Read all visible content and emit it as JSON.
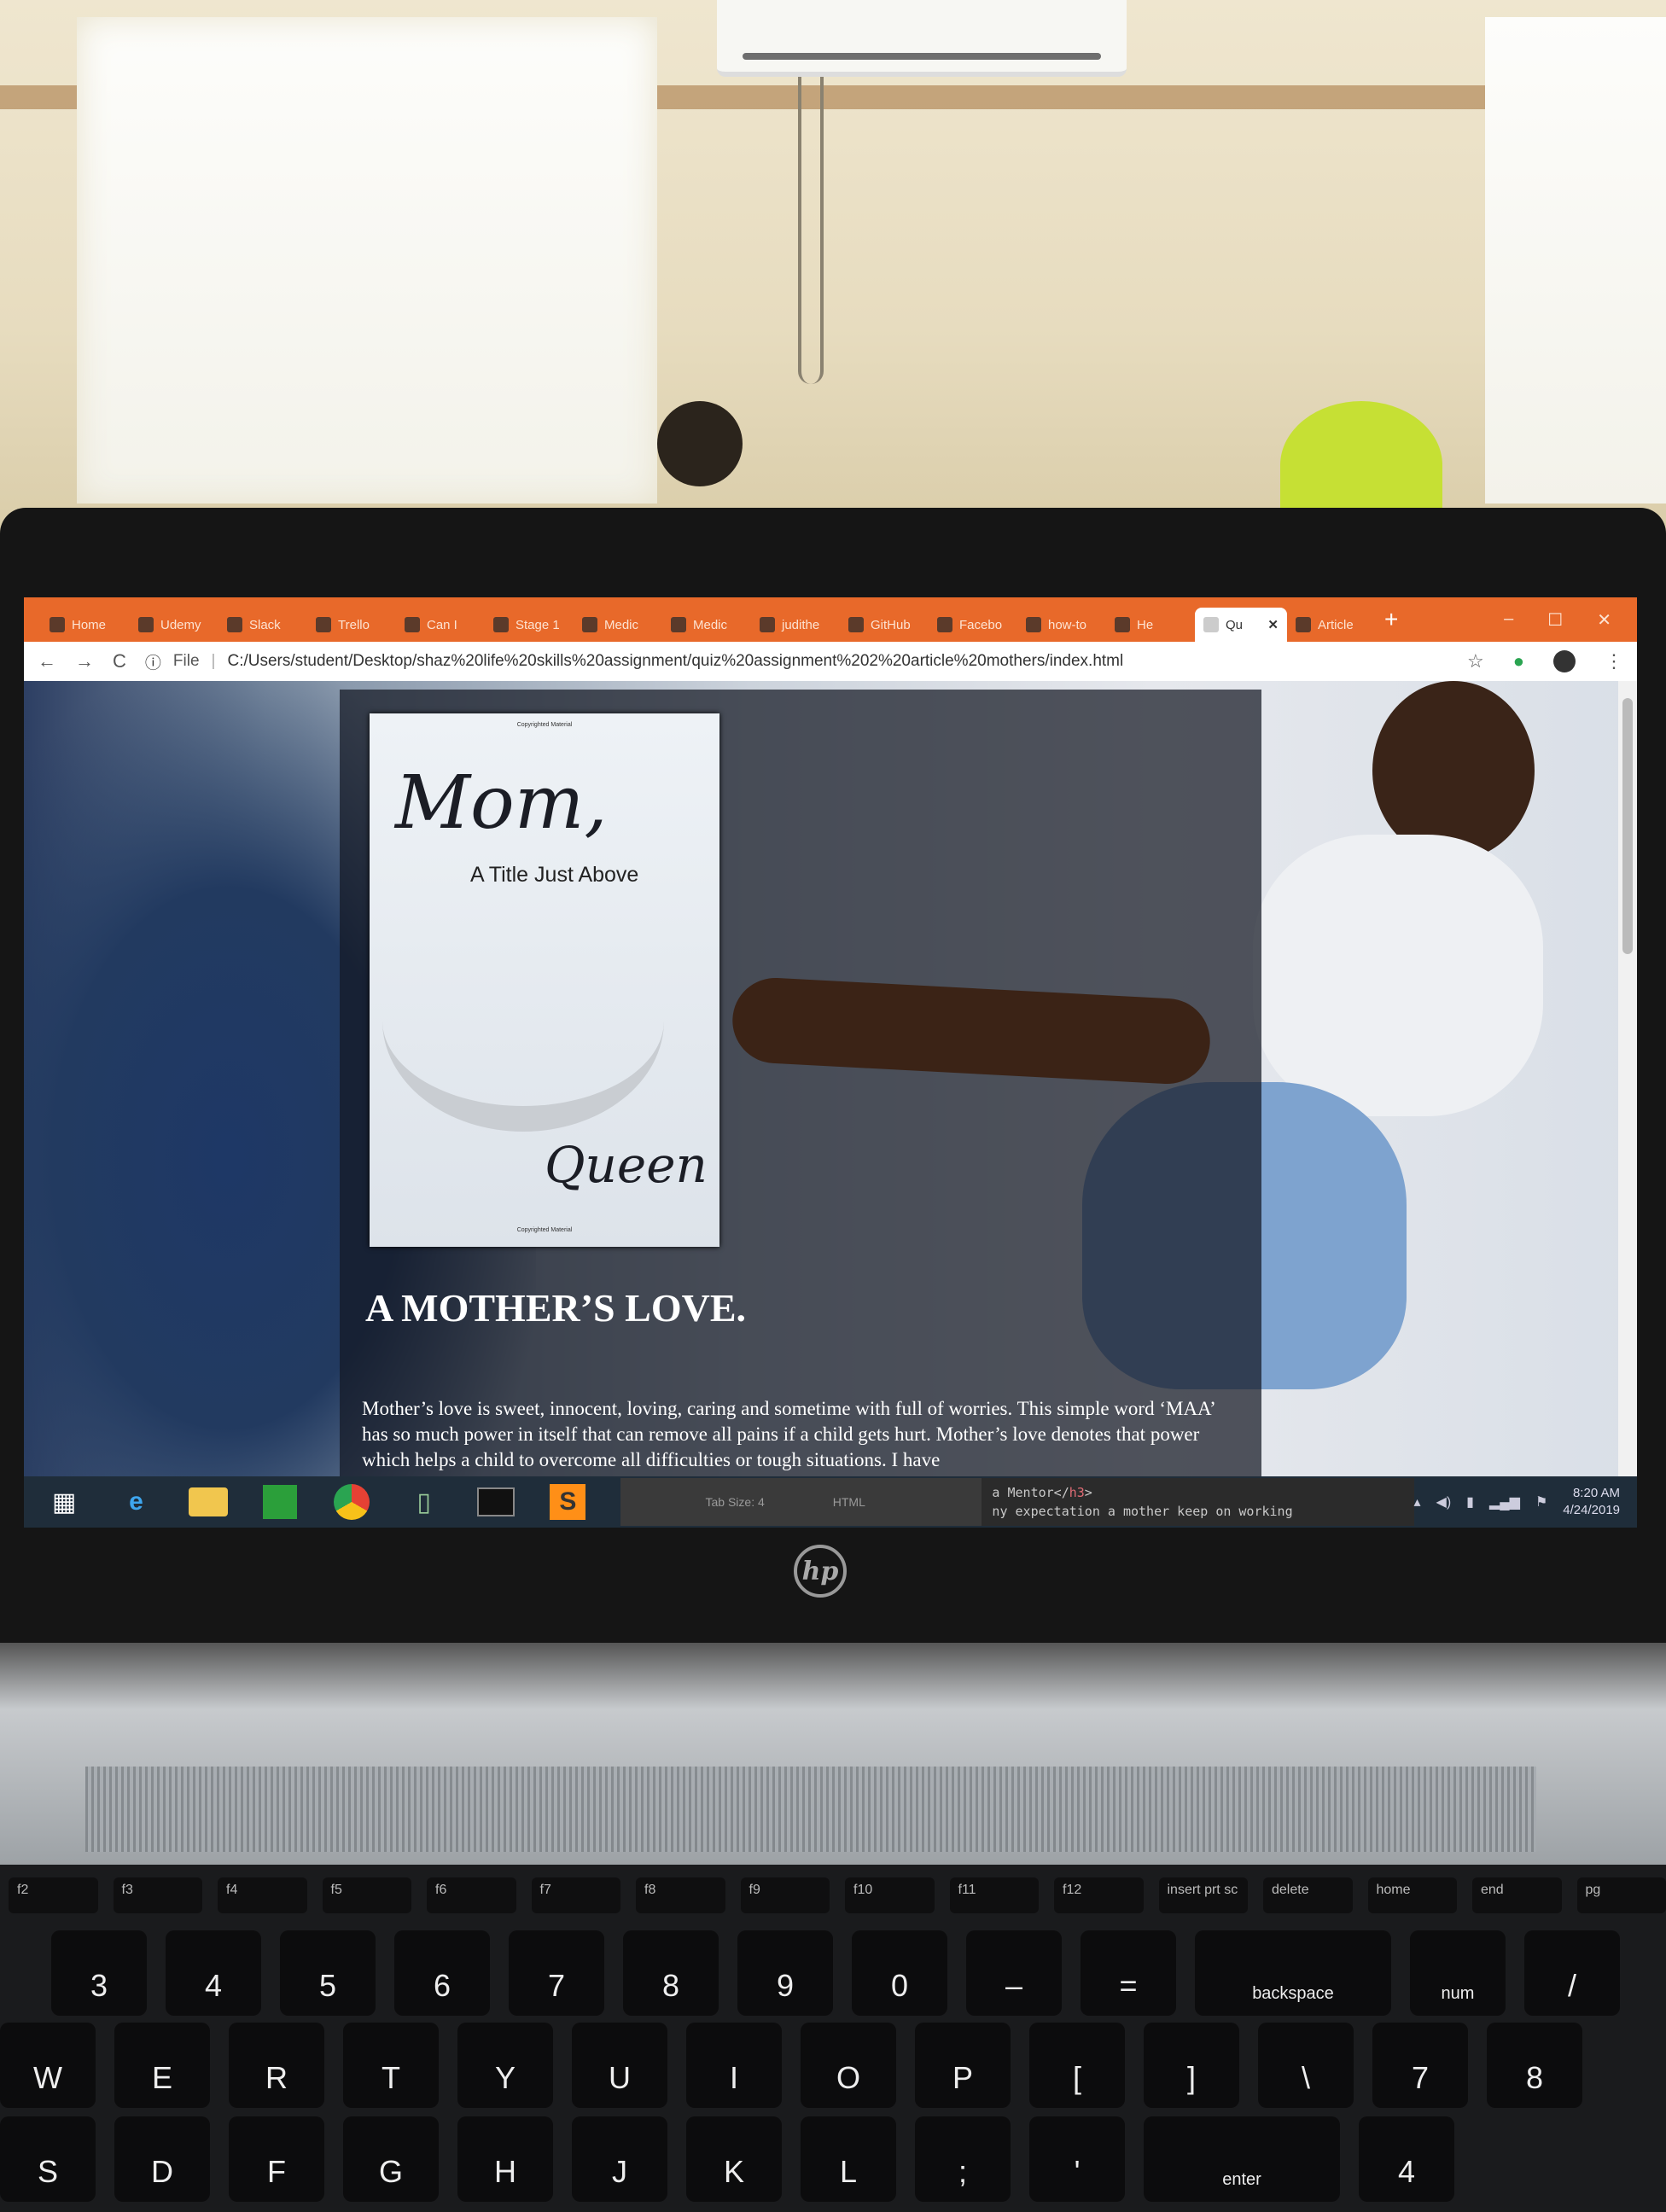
{
  "browser": {
    "tabs": [
      {
        "label": "Home",
        "active": false
      },
      {
        "label": "Udemy",
        "active": false
      },
      {
        "label": "Slack",
        "active": false
      },
      {
        "label": "Trello",
        "active": false
      },
      {
        "label": "Can I",
        "active": false
      },
      {
        "label": "Stage 1",
        "active": false
      },
      {
        "label": "Medic",
        "active": false
      },
      {
        "label": "Medic",
        "active": false
      },
      {
        "label": "judithe",
        "active": false
      },
      {
        "label": "GitHub",
        "active": false
      },
      {
        "label": "Facebo",
        "active": false
      },
      {
        "label": "how-to",
        "active": false
      },
      {
        "label": "He",
        "active": false
      },
      {
        "label": "Qu",
        "active": true
      },
      {
        "label": "Article",
        "active": false
      }
    ],
    "new_tab": "+",
    "window_controls": {
      "minimize": "–",
      "maximize": "☐",
      "close": "✕"
    },
    "nav": {
      "back": "←",
      "forward": "→",
      "reload": "C"
    },
    "address": {
      "scheme_label": "File",
      "url": "C:/Users/student/Desktop/shaz%20life%20skills%20assignment/quiz%20assignment%202%20article%20mothers/index.html"
    }
  },
  "page": {
    "book_cover": {
      "top_note": "Copyrighted Material",
      "title": "Mom,",
      "subtitle": "A Title Just Above",
      "word": "Queen",
      "bottom_note": "Copyrighted Material"
    },
    "headline": "A MOTHER’S LOVE.",
    "paragraph": "Mother’s love is sweet, innocent, loving, caring and sometime with full of worries. This simple word ‘MAA’ has so much power in itself that can remove all pains if a child gets hurt. Mother’s love denotes that power which helps a child to overcome all difficulties or tough situations. I have"
  },
  "taskbar": {
    "editor_status": {
      "tab_size": "Tab Size: 4",
      "syntax": "HTML"
    },
    "code_line_1": "a Mentor</",
    "code_tag": "h3",
    "code_line_1_end": ">",
    "code_line_2": "ny expectation a mother keep on working",
    "time": "8:20 AM",
    "date": "4/24/2019"
  },
  "laptop": {
    "brand": "hp"
  },
  "keyboard": {
    "fkeys": [
      "f2",
      "f3",
      "f4",
      "f5",
      "f6",
      "f7",
      "f8",
      "f9",
      "f10",
      "f11",
      "f12",
      "insert prt sc",
      "delete",
      "home",
      "end",
      "pg"
    ],
    "numrow": [
      "3",
      "4",
      "5",
      "6",
      "7",
      "8",
      "9",
      "0",
      "–",
      "=",
      "backspace",
      "num",
      "/"
    ],
    "toprow": [
      "W",
      "E",
      "R",
      "T",
      "Y",
      "U",
      "I",
      "O",
      "P",
      "[",
      "]",
      "\\",
      "7",
      "8"
    ],
    "homerow": [
      "S",
      "D",
      "F",
      "G",
      "H",
      "J",
      "K",
      "L",
      ";",
      "'",
      "enter",
      "4"
    ]
  }
}
